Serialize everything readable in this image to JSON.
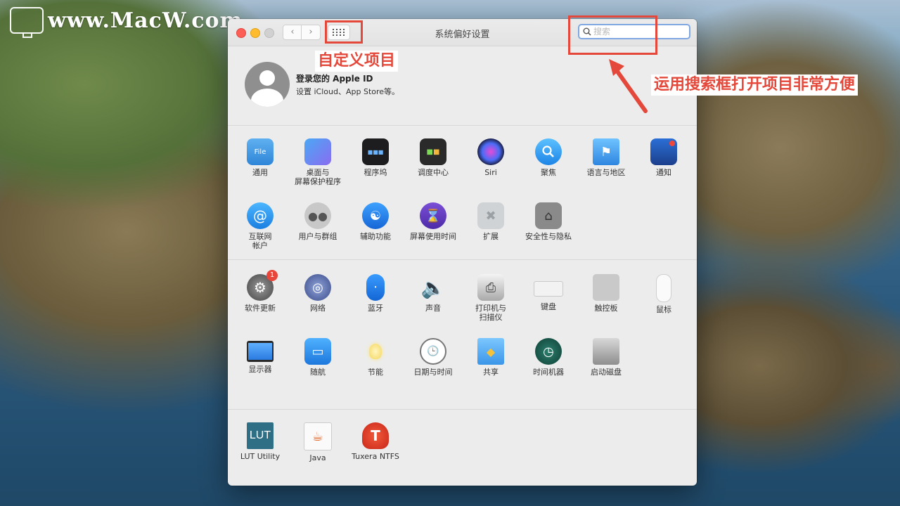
{
  "watermark": {
    "text": "www.MacW.com"
  },
  "window": {
    "title": "系统偏好设置",
    "search_placeholder": "搜索"
  },
  "apple_id": {
    "title": "登录您的 Apple ID",
    "subtitle": "设置 iCloud、App Store等。"
  },
  "section1": {
    "items": [
      {
        "label": "通用",
        "icon": "general-icon"
      },
      {
        "label": "桌面与\n屏幕保护程序",
        "icon": "desktop-icon"
      },
      {
        "label": "程序坞",
        "icon": "dock-icon"
      },
      {
        "label": "调度中心",
        "icon": "mission-control-icon"
      },
      {
        "label": "Siri",
        "icon": "siri-icon"
      },
      {
        "label": "聚焦",
        "icon": "spotlight-icon"
      },
      {
        "label": "语言与地区",
        "icon": "language-icon"
      },
      {
        "label": "通知",
        "icon": "notifications-icon"
      },
      {
        "label": "互联网\n帐户",
        "icon": "internet-accounts-icon"
      },
      {
        "label": "用户与群组",
        "icon": "users-icon"
      },
      {
        "label": "辅助功能",
        "icon": "accessibility-icon"
      },
      {
        "label": "屏幕使用时间",
        "icon": "screen-time-icon"
      },
      {
        "label": "扩展",
        "icon": "extensions-icon"
      },
      {
        "label": "安全性与隐私",
        "icon": "security-icon"
      }
    ]
  },
  "section2": {
    "items": [
      {
        "label": "软件更新",
        "icon": "software-update-icon",
        "badge": "1"
      },
      {
        "label": "网络",
        "icon": "network-icon"
      },
      {
        "label": "蓝牙",
        "icon": "bluetooth-icon"
      },
      {
        "label": "声音",
        "icon": "sound-icon"
      },
      {
        "label": "打印机与\n扫描仪",
        "icon": "printer-icon"
      },
      {
        "label": "键盘",
        "icon": "keyboard-icon"
      },
      {
        "label": "触控板",
        "icon": "trackpad-icon"
      },
      {
        "label": "鼠标",
        "icon": "mouse-icon"
      },
      {
        "label": "显示器",
        "icon": "displays-icon"
      },
      {
        "label": "随航",
        "icon": "sidecar-icon"
      },
      {
        "label": "节能",
        "icon": "energy-saver-icon"
      },
      {
        "label": "日期与时间",
        "icon": "date-time-icon"
      },
      {
        "label": "共享",
        "icon": "sharing-icon"
      },
      {
        "label": "时间机器",
        "icon": "time-machine-icon"
      },
      {
        "label": "启动磁盘",
        "icon": "startup-disk-icon"
      }
    ]
  },
  "section3": {
    "items": [
      {
        "label": "LUT Utility",
        "icon": "lut-utility-icon",
        "icon_text": "LUT"
      },
      {
        "label": "Java",
        "icon": "java-icon"
      },
      {
        "label": "Tuxera NTFS",
        "icon": "tuxera-icon",
        "icon_text": "T"
      }
    ]
  },
  "annotations": {
    "customize": "自定义项目",
    "search_tip": "运用搜索框打开项目非常方便",
    "color": "#e4483a"
  }
}
